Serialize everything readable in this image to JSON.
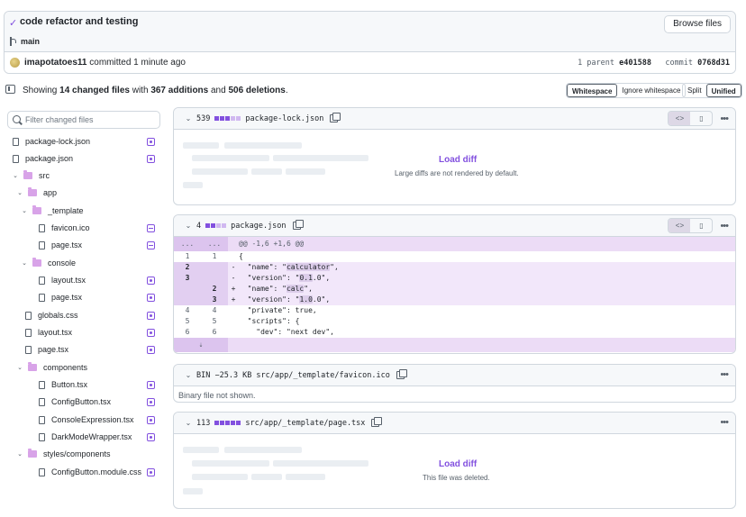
{
  "commit": {
    "title": "code refactor and testing",
    "branch": "main",
    "browse_label": "Browse files",
    "author": "imapotatoes11",
    "committed_text": "committed 1 minute ago",
    "parent_label": "1 parent",
    "parent_sha": "e401588",
    "commit_label": "commit",
    "commit_sha": "0768d31"
  },
  "summary": {
    "prefix": "Showing",
    "changed": "14 changed files",
    "with": "with",
    "additions": "367 additions",
    "and": "and",
    "deletions": "506 deletions",
    "period": ".",
    "whitespace": "Whitespace",
    "ignore_whitespace": "Ignore whitespace",
    "split": "Split",
    "unified": "Unified"
  },
  "filter": {
    "placeholder": "Filter changed files"
  },
  "tree": [
    {
      "name": "package-lock.json",
      "kind": "file",
      "status": "mod"
    },
    {
      "name": "package.json",
      "kind": "file",
      "status": "mod"
    },
    {
      "name": "src",
      "kind": "folder"
    },
    {
      "name": "app",
      "kind": "folder"
    },
    {
      "name": "_template",
      "kind": "folder"
    },
    {
      "name": "favicon.ico",
      "kind": "file",
      "status": "del"
    },
    {
      "name": "page.tsx",
      "kind": "file",
      "status": "del"
    },
    {
      "name": "console",
      "kind": "folder"
    },
    {
      "name": "layout.tsx",
      "kind": "file",
      "status": "mod"
    },
    {
      "name": "page.tsx",
      "kind": "file",
      "status": "mod"
    },
    {
      "name": "globals.css",
      "kind": "file",
      "status": "mod"
    },
    {
      "name": "layout.tsx",
      "kind": "file",
      "status": "mod"
    },
    {
      "name": "page.tsx",
      "kind": "file",
      "status": "mod"
    },
    {
      "name": "components",
      "kind": "folder"
    },
    {
      "name": "Button.tsx",
      "kind": "file",
      "status": "mod"
    },
    {
      "name": "ConfigButton.tsx",
      "kind": "file",
      "status": "mod"
    },
    {
      "name": "ConsoleExpression.tsx",
      "kind": "file",
      "status": "mod"
    },
    {
      "name": "DarkModeWrapper.tsx",
      "kind": "file",
      "status": "mod"
    },
    {
      "name": "styles/components",
      "kind": "folder"
    },
    {
      "name": "ConfigButton.module.css",
      "kind": "file",
      "status": "mod"
    }
  ],
  "files": {
    "lock": {
      "count": "539",
      "name": "package-lock.json",
      "load": "Load diff",
      "note": "Large diffs are not rendered by default."
    },
    "pkg": {
      "count": "4",
      "name": "package.json"
    },
    "favicon": {
      "count": "BIN −25.3 KB",
      "name": "src/app/_template/favicon.ico",
      "note": "Binary file not shown."
    },
    "page": {
      "count": "113",
      "name": "src/app/_template/page.tsx",
      "load": "Load diff",
      "note": "This file was deleted."
    }
  },
  "diff": {
    "hunk_old": "...",
    "hunk_new": "...",
    "hunk_text": "@@ -1,6 +1,6 @@",
    "lines": [
      {
        "type": "ctx",
        "old": "1",
        "new": "1",
        "sign": "",
        "code": "{"
      },
      {
        "type": "del",
        "old": "2",
        "new": "",
        "sign": "-",
        "pre": "  \"name\": \"",
        "hl": "calculator",
        "post": "\","
      },
      {
        "type": "del",
        "old": "3",
        "new": "",
        "sign": "-",
        "pre": "  \"version\": \"",
        "hl": "0.1",
        "post": ".0\","
      },
      {
        "type": "add",
        "old": "",
        "new": "2",
        "sign": "+",
        "pre": "  \"name\": \"",
        "hl": "calc",
        "post": "\","
      },
      {
        "type": "add",
        "old": "",
        "new": "3",
        "sign": "+",
        "pre": "  \"version\": \"",
        "hl": "1.0",
        "post": ".0\","
      },
      {
        "type": "ctx",
        "old": "4",
        "new": "4",
        "sign": "",
        "code": "  \"private\": true,"
      },
      {
        "type": "ctx",
        "old": "5",
        "new": "5",
        "sign": "",
        "code": "  \"scripts\": {"
      },
      {
        "type": "ctx",
        "old": "6",
        "new": "6",
        "sign": "",
        "code": "    \"dev\": \"next dev\","
      }
    ]
  }
}
